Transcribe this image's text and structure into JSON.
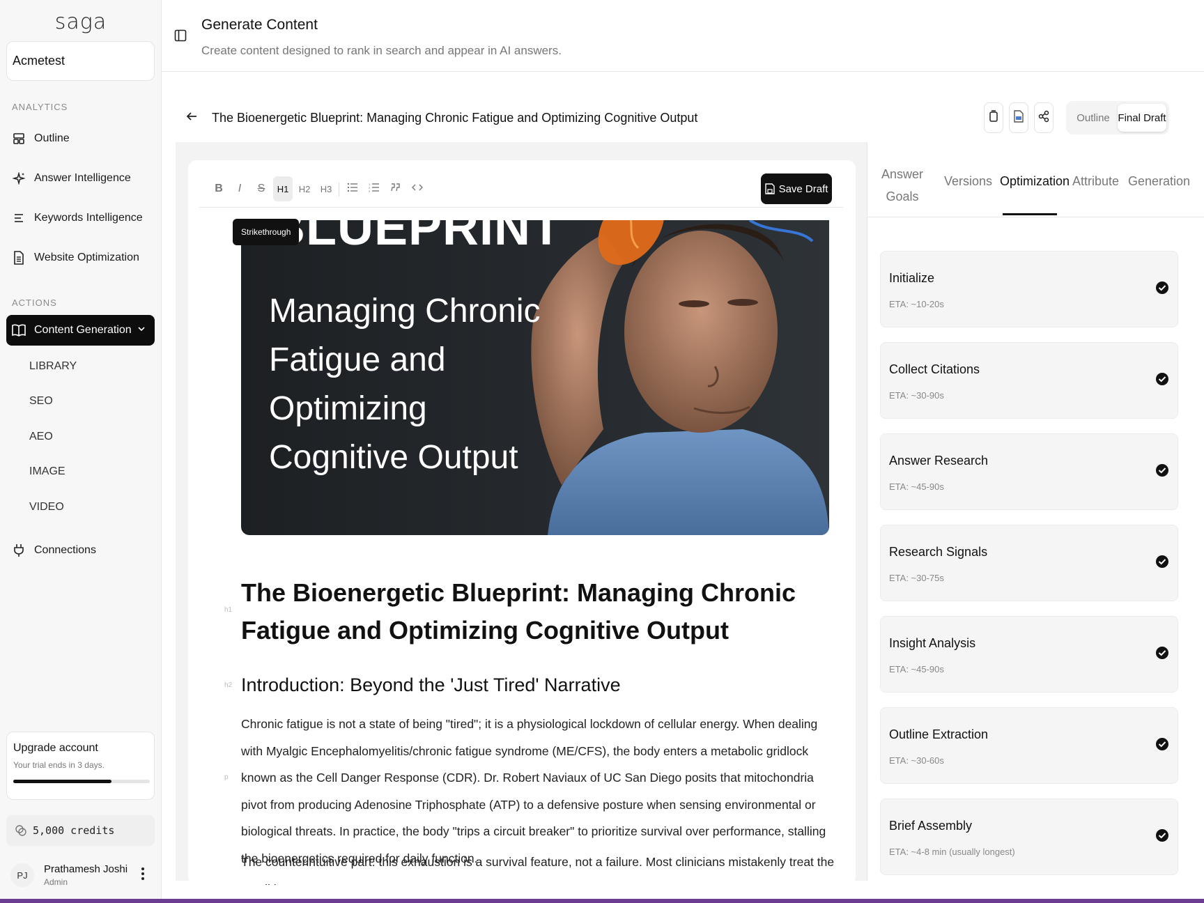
{
  "sidebar": {
    "logo": "saga",
    "workspace": "Acmetest",
    "analytics_label": "ANALYTICS",
    "analytics_items": [
      {
        "label": "Outline",
        "icon": "layout-icon"
      },
      {
        "label": "Answer Intelligence",
        "icon": "sparkles-icon"
      },
      {
        "label": "Keywords Intelligence",
        "icon": "list-icon"
      },
      {
        "label": "Website Optimization",
        "icon": "document-icon"
      }
    ],
    "actions_label": "ACTIONS",
    "active_item": {
      "label": "Content Generation",
      "icon": "book-icon"
    },
    "sub_items": [
      "LIBRARY",
      "SEO",
      "AEO",
      "IMAGE",
      "VIDEO"
    ],
    "connections": {
      "label": "Connections",
      "icon": "plug-icon"
    },
    "upgrade": {
      "title": "Upgrade account",
      "subtitle": "Your trial ends in 3 days.",
      "progress": 0.72
    },
    "credits": "5,000 credits",
    "user": {
      "initials": "PJ",
      "name": "Prathamesh Joshi",
      "role": "Admin"
    }
  },
  "header": {
    "title": "Generate Content",
    "subtitle": "Create content designed to rank in search and appear in AI answers."
  },
  "doc": {
    "title": "The Bioenergetic Blueprint: Managing Chronic Fatigue and Optimizing Cognitive Output",
    "view_options": [
      "Outline",
      "Final Draft"
    ],
    "active_view": "Final Draft"
  },
  "editor": {
    "toolbar": [
      "B",
      "I",
      "S",
      "H1",
      "H2",
      "H3",
      "bullet-list",
      "ordered-list",
      "quote",
      "code"
    ],
    "save_label": "Save Draft",
    "tooltip": "Strikethrough",
    "hero": {
      "big": "BLUEPRINT",
      "lines": [
        "Managing Chronic",
        "Fatigue and Optimizing",
        "Cognitive Output"
      ]
    },
    "gutter": {
      "h1": "h1",
      "h2": "h2",
      "p": "p"
    },
    "h1": "The Bioenergetic Blueprint: Managing Chronic Fatigue and Optimizing Cognitive Output",
    "h2": "Introduction: Beyond the 'Just Tired' Narrative",
    "p1": "Chronic fatigue is not a state of being \"tired\"; it is a physiological lockdown of cellular energy. When dealing with Myalgic Encephalomyelitis/chronic fatigue syndrome (ME/CFS), the body enters a metabolic gridlock known as the Cell Danger Response (CDR). Dr. Robert Naviaux of UC San Diego posits that mitochondria pivot from producing Adenosine Triphosphate (ATP) to a defensive posture when sensing environmental or biological threats. In practice, the body \"trips a circuit breaker\" to prioritize survival over performance, stalling the bioenergetics required for daily function.",
    "p2": "The counterintuitive part: this exhaustion is a survival feature, not a failure. Most clinicians mistakenly treat the condition as"
  },
  "right_panel": {
    "tabs": [
      "Answer Goals",
      "Versions",
      "Optimization",
      "Attribute",
      "Generation"
    ],
    "active_tab": "Optimization",
    "steps": [
      {
        "name": "Initialize",
        "eta": "ETA: ~10-20s"
      },
      {
        "name": "Collect Citations",
        "eta": "ETA: ~30-90s"
      },
      {
        "name": "Answer Research",
        "eta": "ETA: ~45-90s"
      },
      {
        "name": "Research Signals",
        "eta": "ETA: ~30-75s"
      },
      {
        "name": "Insight Analysis",
        "eta": "ETA: ~45-90s"
      },
      {
        "name": "Outline Extraction",
        "eta": "ETA: ~30-60s"
      },
      {
        "name": "Brief Assembly",
        "eta": "ETA: ~4-8 min (usually longest)"
      }
    ]
  }
}
